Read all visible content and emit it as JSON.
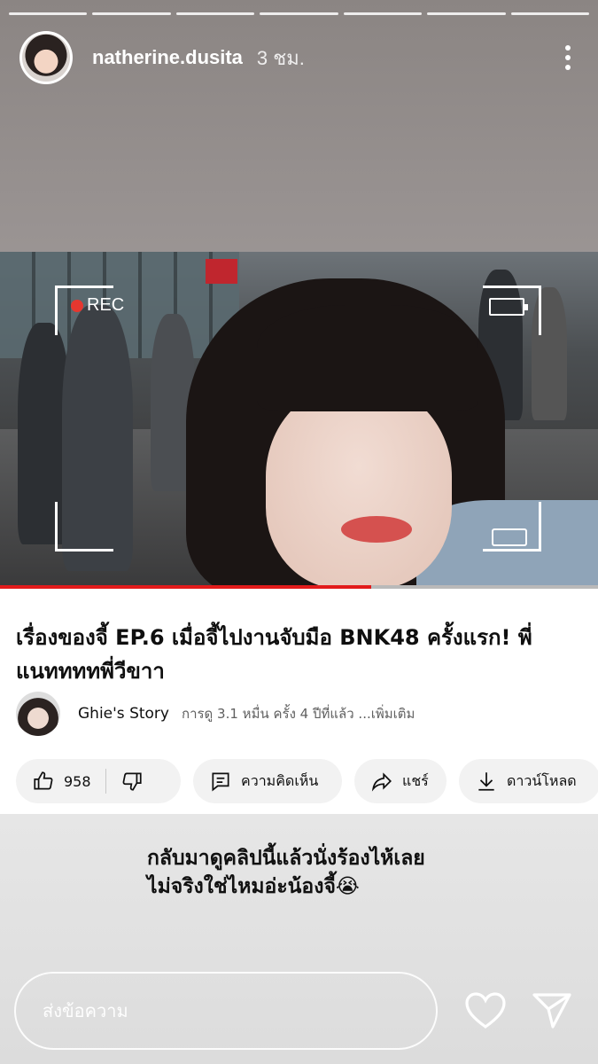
{
  "story": {
    "username": "natherine.dusita",
    "time": "3 ชม.",
    "progress_segments": 7,
    "more_icon": "more-vertical-icon"
  },
  "video": {
    "rec_label": "REC",
    "progress_fraction": 0.62
  },
  "youtube": {
    "title": "เรื่องของจี้ EP.6 เมื่อจี้ไปงานจับมือ BNK48 ครั้งแรก! พี่แนททททพี่วีขาา",
    "channel": "Ghie's Story",
    "meta": "การดู 3.1 หมื่น ครั้ง  4 ปีที่แล้ว  ...เพิ่มเติม",
    "like_count": "958",
    "comment_label": "ความคิดเห็น",
    "share_label": "แชร์",
    "download_label": "ดาวน์โหลด"
  },
  "caption": {
    "line1": "กลับมาดูคลิปนี้แล้วนั่งร้องไห้เลย",
    "line2": "ไม่จริงใช่ไหมอ่ะน้องจี้😭"
  },
  "reply": {
    "placeholder": "ส่งข้อความ"
  }
}
